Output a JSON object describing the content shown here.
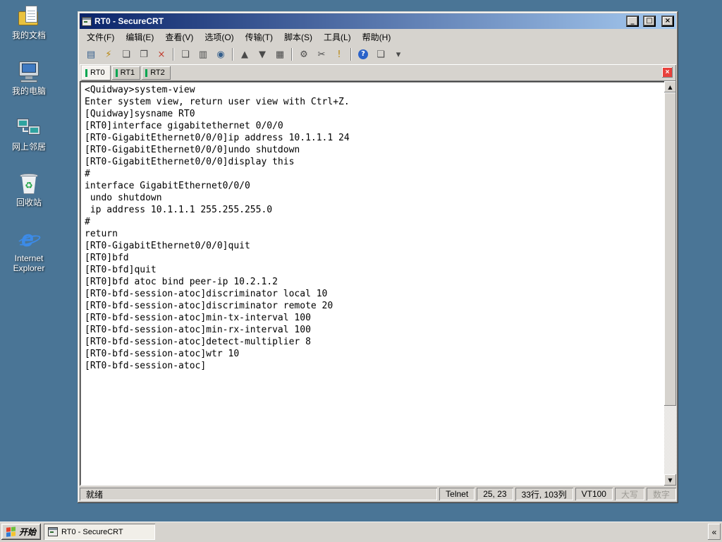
{
  "colors": {
    "desktop_bg": "#4a7596",
    "chrome": "#d6d3ce",
    "titlebar_start": "#0a246a",
    "titlebar_end": "#a6caf0",
    "terminal_bg": "#ffffff",
    "terminal_fg": "#000000",
    "tab_indicator": "#00a651",
    "tab_close_bg": "#e8413c"
  },
  "desktop": {
    "icons": [
      {
        "label": "我的文档"
      },
      {
        "label": "我的电脑"
      },
      {
        "label": "网上邻居"
      },
      {
        "label": "回收站"
      },
      {
        "label": "Internet Explorer"
      }
    ]
  },
  "window": {
    "title": "RT0 - SecureCRT",
    "controls": {
      "minimize": "_",
      "maximize": "□",
      "close": "×"
    },
    "menu": [
      "文件(F)",
      "编辑(E)",
      "查看(V)",
      "选项(O)",
      "传输(T)",
      "脚本(S)",
      "工具(L)",
      "帮助(H)"
    ],
    "toolbar": [
      {
        "name": "connect",
        "glyph": "▤"
      },
      {
        "name": "quick-connect",
        "glyph": "⚡"
      },
      {
        "name": "new-session",
        "glyph": "❏"
      },
      {
        "name": "clone-session",
        "glyph": "❐"
      },
      {
        "name": "disconnect",
        "glyph": "×"
      },
      {
        "name": "copy",
        "glyph": "❑"
      },
      {
        "name": "paste",
        "glyph": "▥"
      },
      {
        "name": "find",
        "glyph": "◉"
      },
      {
        "name": "upload",
        "glyph": "▲"
      },
      {
        "name": "download",
        "glyph": "▼"
      },
      {
        "name": "print",
        "glyph": "▦"
      },
      {
        "name": "session-options",
        "glyph": "⚙"
      },
      {
        "name": "cut",
        "glyph": "✂"
      },
      {
        "name": "alert",
        "glyph": "!"
      },
      {
        "name": "help",
        "glyph": "?"
      },
      {
        "name": "new-window",
        "glyph": "❏"
      },
      {
        "name": "toolbar-overflow",
        "glyph": "▾"
      }
    ],
    "tabs": [
      {
        "label": "RT0",
        "active": true
      },
      {
        "label": "RT1",
        "active": false
      },
      {
        "label": "RT2",
        "active": false
      }
    ],
    "tab_close": "×",
    "scrollbar": {
      "up": "▲",
      "down": "▼"
    },
    "terminal_lines": [
      "<Quidway>system-view",
      "Enter system view, return user view with Ctrl+Z.",
      "[Quidway]sysname RT0",
      "[RT0]interface gigabitethernet 0/0/0",
      "[RT0-GigabitEthernet0/0/0]ip address 10.1.1.1 24",
      "[RT0-GigabitEthernet0/0/0]undo shutdown",
      "[RT0-GigabitEthernet0/0/0]display this",
      "#",
      "interface GigabitEthernet0/0/0",
      " undo shutdown",
      " ip address 10.1.1.1 255.255.255.0",
      "#",
      "return",
      "[RT0-GigabitEthernet0/0/0]quit",
      "[RT0]bfd",
      "[RT0-bfd]quit",
      "[RT0]bfd atoc bind peer-ip 10.2.1.2",
      "[RT0-bfd-session-atoc]discriminator local 10",
      "[RT0-bfd-session-atoc]discriminator remote 20",
      "[RT0-bfd-session-atoc]min-tx-interval 100",
      "[RT0-bfd-session-atoc]min-rx-interval 100",
      "[RT0-bfd-session-atoc]detect-multiplier 8",
      "[RT0-bfd-session-atoc]wtr 10",
      "[RT0-bfd-session-atoc]"
    ],
    "statusbar": {
      "ready": "就绪",
      "protocol": "Telnet",
      "cursor": "25, 23",
      "grid": "33行, 103列",
      "emulation": "VT100",
      "caps": "大写",
      "num": "数字"
    }
  },
  "taskbar": {
    "start_label": "开始",
    "task_label": "RT0 - SecureCRT",
    "chevron": "«"
  }
}
